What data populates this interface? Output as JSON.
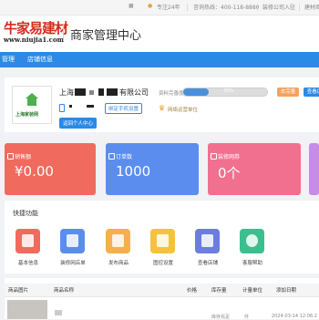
{
  "topbar": {
    "slogan": "专注24年",
    "hotline": "咨询热线：400-118-8880",
    "join": "装修公司入驻",
    "materials": "建材商"
  },
  "header": {
    "logo_text": "牛家易建材",
    "logo_url": "www.niujia1.com",
    "title": "商家管理中心"
  },
  "nav": {
    "items": [
      {
        "label": "管理"
      },
      {
        "label": "店铺信息"
      }
    ]
  },
  "profile": {
    "logo_caption": "上海家装网",
    "company_name_prefix": "上海",
    "company_name_suffix": "有限公司",
    "phone_bind_label": "绑定手机设置",
    "badge_label": "网络运营单位",
    "center_button": "返回个人中心",
    "completeness_label": "资料完善度：",
    "completeness_percent": "30%",
    "completeness_value": 0.3,
    "orange_button": "去完善",
    "blue_button": "查看店"
  },
  "stats": [
    {
      "label": "销售额",
      "value": "¥0.00",
      "color": "#f06b5d"
    },
    {
      "label": "订单数",
      "value": "1000",
      "color": "#5b8def"
    },
    {
      "label": "装修网券",
      "value": "0个",
      "color": "#f2708f"
    }
  ],
  "quick_actions": {
    "title": "快捷功能",
    "items": [
      {
        "label": "基本信息",
        "color": "#f06b5d",
        "icon": "profile-icon"
      },
      {
        "label": "装修网店单",
        "color": "#5b8def",
        "icon": "document-icon"
      },
      {
        "label": "发布商品",
        "color": "#f5b04d",
        "icon": "gift-icon"
      },
      {
        "label": "图控设置",
        "color": "#f5c23c",
        "icon": "smile-icon"
      },
      {
        "label": "查看店铺",
        "color": "#6c7de0",
        "icon": "store-icon"
      },
      {
        "label": "客服帮助",
        "color": "#3bbf8e",
        "icon": "service-icon"
      }
    ]
  },
  "table": {
    "headers": [
      "商品图片",
      "商品名称",
      "价格",
      "库存量",
      "计量单位",
      "添加日期"
    ],
    "row": {
      "stock": "库存充足",
      "unit": "件",
      "date": "2024-03-14 12:06:2"
    }
  }
}
